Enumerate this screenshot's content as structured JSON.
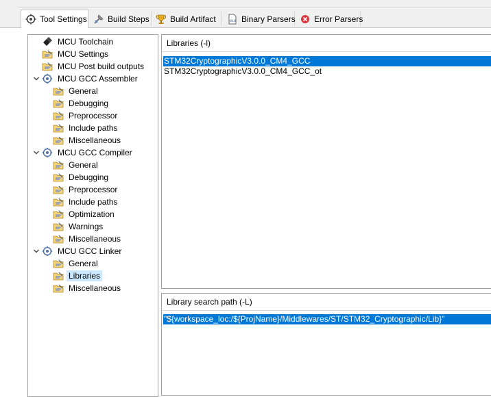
{
  "tabs": [
    {
      "label": "Tool Settings",
      "icon": "gear-icon",
      "active": true
    },
    {
      "label": "Build Steps",
      "icon": "build-steps-icon",
      "active": false
    },
    {
      "label": "Build Artifact",
      "icon": "trophy-icon",
      "active": false
    },
    {
      "label": "Binary Parsers",
      "icon": "binary-icon",
      "active": false
    },
    {
      "label": "Error Parsers",
      "icon": "error-icon",
      "active": false
    }
  ],
  "tree": [
    {
      "label": "MCU Toolchain",
      "icon": "toolchain-icon",
      "expand": ""
    },
    {
      "label": "MCU Settings",
      "icon": "settings-folder-icon",
      "expand": ""
    },
    {
      "label": "MCU Post build outputs",
      "icon": "settings-folder-icon",
      "expand": ""
    },
    {
      "label": "MCU GCC Assembler",
      "icon": "tool-icon",
      "expand": "expanded"
    },
    {
      "label": "General",
      "icon": "settings-folder-icon",
      "expand": ""
    },
    {
      "label": "Debugging",
      "icon": "settings-folder-icon",
      "expand": ""
    },
    {
      "label": "Preprocessor",
      "icon": "settings-folder-icon",
      "expand": ""
    },
    {
      "label": "Include paths",
      "icon": "settings-folder-icon",
      "expand": ""
    },
    {
      "label": "Miscellaneous",
      "icon": "settings-folder-icon",
      "expand": ""
    },
    {
      "label": "MCU GCC Compiler",
      "icon": "tool-icon",
      "expand": "expanded"
    },
    {
      "label": "General",
      "icon": "settings-folder-icon",
      "expand": ""
    },
    {
      "label": "Debugging",
      "icon": "settings-folder-icon",
      "expand": ""
    },
    {
      "label": "Preprocessor",
      "icon": "settings-folder-icon",
      "expand": ""
    },
    {
      "label": "Include paths",
      "icon": "settings-folder-icon",
      "expand": ""
    },
    {
      "label": "Optimization",
      "icon": "settings-folder-icon",
      "expand": ""
    },
    {
      "label": "Warnings",
      "icon": "settings-folder-icon",
      "expand": ""
    },
    {
      "label": "Miscellaneous",
      "icon": "settings-folder-icon",
      "expand": ""
    },
    {
      "label": "MCU GCC Linker",
      "icon": "tool-icon",
      "expand": "expanded"
    },
    {
      "label": "General",
      "icon": "settings-folder-icon",
      "expand": ""
    },
    {
      "label": "Libraries",
      "icon": "settings-folder-icon",
      "expand": "",
      "selected": true
    },
    {
      "label": "Miscellaneous",
      "icon": "settings-folder-icon",
      "expand": ""
    }
  ],
  "libraries": {
    "title": "Libraries (-l)",
    "items": [
      {
        "value": "STM32CryptographicV3.0.0_CM4_GCC",
        "selected": true
      },
      {
        "value": "STM32CryptographicV3.0.0_CM4_GCC_ot",
        "selected": false
      }
    ]
  },
  "search_path": {
    "title": "Library search path (-L)",
    "items": [
      {
        "value": "\"${workspace_loc:/${ProjName}/Middlewares/ST/STM32_Cryptographic/Lib}\"",
        "selected": true
      }
    ]
  },
  "colors": {
    "selection": "#0078d7",
    "tree_selection": "#cce8ff",
    "folder": "#e8b84a"
  }
}
